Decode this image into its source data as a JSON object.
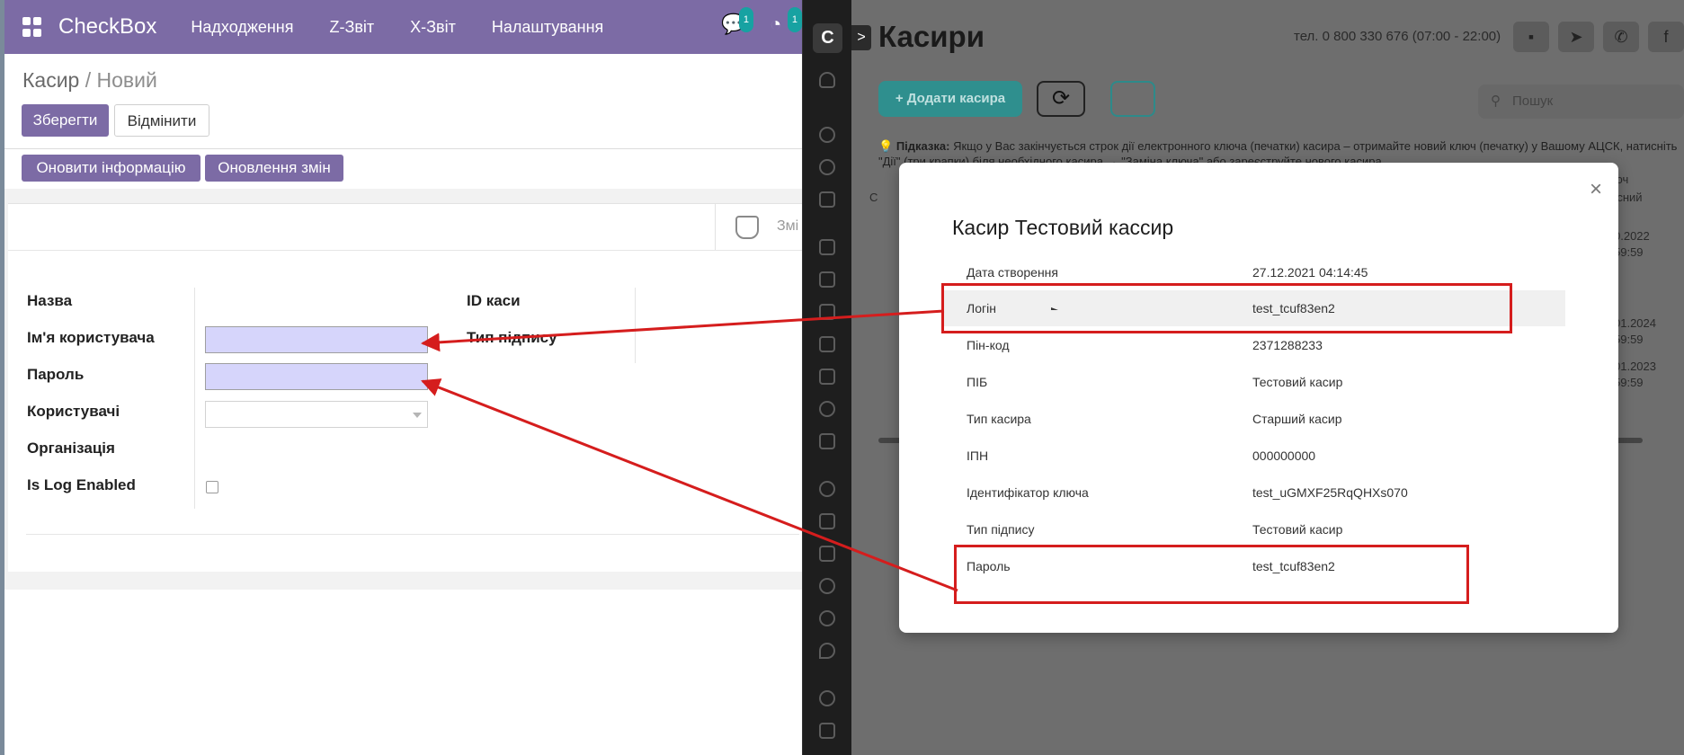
{
  "odoo": {
    "brand": "CheckBox",
    "menu": [
      "Надходження",
      "Z-Звіт",
      "X-Звіт",
      "Налаштування"
    ],
    "badges": {
      "messages": "1",
      "activities": "1"
    },
    "breadcrumb": {
      "parent": "Касир",
      "sep": " / ",
      "current": "Новий"
    },
    "buttons": {
      "save": "Зберегти",
      "discard": "Відмінити",
      "update_info": "Оновити інформацію",
      "update_shifts": "Оновлення змін"
    },
    "stat_button": "Змі",
    "labels": {
      "name": "Назва",
      "username": "Ім'я користувача",
      "password": "Пароль",
      "users": "Користувачі",
      "organization": "Організація",
      "log_enabled": "Is Log Enabled",
      "cash_id": "ID каси",
      "sign_type": "Тип підпису"
    }
  },
  "checkbox": {
    "logo": "C",
    "expand": ">",
    "title": "Касири",
    "phone": "тел. 0 800 330 676 (07:00 - 22:00)",
    "add_button": "+ Додати касира",
    "search_placeholder": "Пошук",
    "hint_label": "Підказка:",
    "hint_text": "Якщо у Вас закінчується строк дії електронного ключа (печатки) касира – отримайте новий ключ (печатку) у Вашому АЦСК, натисніть \"Дії\" (три крапки) біля необхідного касира → \"Заміна ключа\" або зареєструйте нового касира.",
    "edge": {
      "col1": "юч",
      "col2": "усний",
      "d1": "0.2022",
      "t1": "59:59",
      "d2": "01.2024",
      "t2": "59:59",
      "d3": "01.2023",
      "t3": "59:59",
      "c": "С"
    }
  },
  "modal": {
    "title": "Касир Тестовий кассир",
    "close": "×",
    "rows": [
      {
        "key": "Дата створення",
        "value": "27.12.2021 04:14:45"
      },
      {
        "key": "Логін",
        "value": "test_tcuf83en2"
      },
      {
        "key": "Пін-код",
        "value": "2371288233"
      },
      {
        "key": "ПІБ",
        "value": "Тестовий касир"
      },
      {
        "key": "Тип касира",
        "value": "Старший касир"
      },
      {
        "key": "ІПН",
        "value": "000000000"
      },
      {
        "key": "Ідентифікатор ключа",
        "value": "test_uGMXF25RqQHXs070"
      },
      {
        "key": "Тип підпису",
        "value": "Тестовий касир"
      },
      {
        "key": "Пароль",
        "value": "test_tcuf83en2"
      }
    ]
  },
  "colors": {
    "odoo_primary": "#7c6ba5",
    "highlight_input": "#d6d5fb",
    "annotation_red": "#d51d1d",
    "checkbox_teal": "#2f8f8e"
  }
}
